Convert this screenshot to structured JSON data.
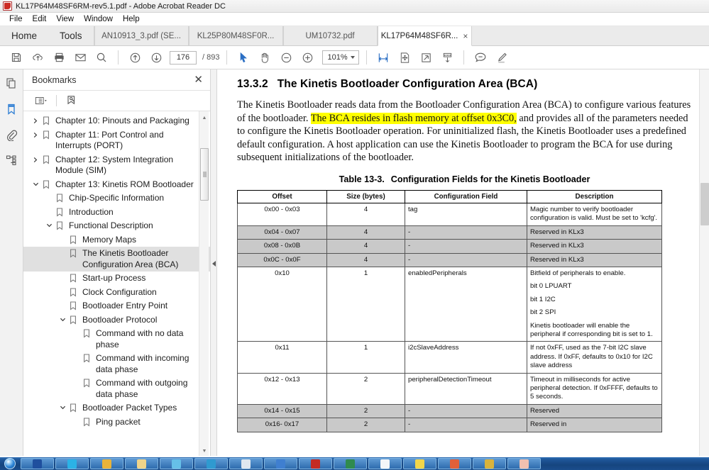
{
  "window": {
    "title": "KL17P64M48SF6RM-rev5.1.pdf - Adobe Acrobat Reader DC",
    "app_icon": "acrobat-logo-icon"
  },
  "menubar": {
    "items": [
      {
        "label": "File"
      },
      {
        "label": "Edit"
      },
      {
        "label": "View"
      },
      {
        "label": "Window"
      },
      {
        "label": "Help"
      }
    ]
  },
  "tabstrip": {
    "home_label": "Home",
    "tools_label": "Tools",
    "doc_tabs": [
      {
        "label": "AN10913_3.pdf (SE...",
        "active": false
      },
      {
        "label": "KL25P80M48SF0R...",
        "active": false
      },
      {
        "label": "UM10732.pdf",
        "active": false
      },
      {
        "label": "KL17P64M48SF6R...",
        "active": true,
        "close": "×"
      }
    ]
  },
  "toolbar": {
    "save_label": "save-icon",
    "upload_label": "cloud-upload-icon",
    "print_label": "print-icon",
    "email_label": "email-icon",
    "search_label": "search-icon",
    "prev_page_label": "previous-page-icon",
    "next_page_label": "next-page-icon",
    "page_number": "176",
    "page_total": "/ 893",
    "select_tool_label": "select-cursor-icon",
    "hand_tool_label": "hand-tool-icon",
    "zoom_out_label": "zoom-out-icon",
    "zoom_in_label": "zoom-in-icon",
    "zoom_value": "101%",
    "fit_width_label": "fit-width-icon",
    "pan_page_label": "pan-page-icon",
    "fit_page_label": "fit-page-icon",
    "read_mode_label": "read-mode-icon",
    "comment_label": "comment-icon",
    "highlight_label": "highlight-pen-icon"
  },
  "rail": {
    "items": [
      {
        "name": "page-thumbnails-icon",
        "active": false
      },
      {
        "name": "bookmarks-icon",
        "active": true
      },
      {
        "name": "attachments-icon",
        "active": false
      },
      {
        "name": "tags-icon",
        "active": false
      }
    ]
  },
  "bookmarks_panel": {
    "title": "Bookmarks",
    "close_label": "✕",
    "options_label": "bookmark-options-icon",
    "new_bookmark_label": "new-bookmark-icon",
    "items": [
      {
        "label": "Chapter 10: Pinouts and Packaging",
        "indent": 0,
        "arrow": "collapsed",
        "selected": false
      },
      {
        "label": "Chapter 11: Port Control and Interrupts (PORT)",
        "indent": 0,
        "arrow": "collapsed",
        "selected": false
      },
      {
        "label": "Chapter 12: System Integration Module (SIM)",
        "indent": 0,
        "arrow": "collapsed",
        "selected": false
      },
      {
        "label": "Chapter 13: Kinetis ROM Bootloader",
        "indent": 0,
        "arrow": "expanded",
        "selected": false
      },
      {
        "label": "Chip-Specific Information",
        "indent": 1,
        "arrow": "none",
        "selected": false
      },
      {
        "label": "Introduction",
        "indent": 1,
        "arrow": "none",
        "selected": false
      },
      {
        "label": "Functional Description",
        "indent": 1,
        "arrow": "expanded",
        "selected": false
      },
      {
        "label": "Memory Maps",
        "indent": 2,
        "arrow": "none",
        "selected": false
      },
      {
        "label": "The Kinetis Bootloader Configuration Area (BCA)",
        "indent": 2,
        "arrow": "none",
        "selected": true
      },
      {
        "label": "Start-up Process",
        "indent": 2,
        "arrow": "none",
        "selected": false
      },
      {
        "label": "Clock Configuration",
        "indent": 2,
        "arrow": "none",
        "selected": false
      },
      {
        "label": "Bootloader Entry Point",
        "indent": 2,
        "arrow": "none",
        "selected": false
      },
      {
        "label": "Bootloader Protocol",
        "indent": 2,
        "arrow": "expanded",
        "selected": false
      },
      {
        "label": "Command with no data phase",
        "indent": 3,
        "arrow": "none",
        "selected": false
      },
      {
        "label": "Command with incoming data phase",
        "indent": 3,
        "arrow": "none",
        "selected": false
      },
      {
        "label": "Command with outgoing data phase",
        "indent": 3,
        "arrow": "none",
        "selected": false
      },
      {
        "label": "Bootloader Packet Types",
        "indent": 2,
        "arrow": "expanded",
        "selected": false
      },
      {
        "label": "Ping packet",
        "indent": 3,
        "arrow": "none",
        "selected": false
      }
    ]
  },
  "document": {
    "heading_number": "13.3.2",
    "heading_title": "The Kinetis Bootloader Configuration Area (BCA)",
    "paragraph": {
      "part1": "The Kinetis Bootloader reads data from the Bootloader Configuration Area (BCA) to configure various features of the bootloader. ",
      "highlight": "The BCA resides in flash memory at offset 0x3C0,",
      "part2": " and provides all of the parameters needed to configure the Kinetis Bootloader operation. For uninitialized flash, the Kinetis Bootloader uses a predefined default configuration. A host application can use the Kinetis Bootloader to program the BCA for use during subsequent initializations of the bootloader."
    },
    "table_caption_number": "Table 13-3.",
    "table_caption_text": "Configuration Fields for the Kinetis Bootloader",
    "table": {
      "headers": [
        "Offset",
        "Size (bytes)",
        "Configuration Field",
        "Description"
      ],
      "rows": [
        {
          "shaded": false,
          "offset": "0x00 - 0x03",
          "size": "4",
          "field": "tag",
          "description_lines": [
            "Magic number to verify bootloader configuration is valid. Must be set to 'kcfg'."
          ]
        },
        {
          "shaded": true,
          "offset": "0x04 - 0x07",
          "size": "4",
          "field": "-",
          "description_lines": [
            "Reserved in KLx3"
          ]
        },
        {
          "shaded": true,
          "offset": "0x08 - 0x0B",
          "size": "4",
          "field": "-",
          "description_lines": [
            "Reserved in KLx3"
          ]
        },
        {
          "shaded": true,
          "offset": "0x0C - 0x0F",
          "size": "4",
          "field": "-",
          "description_lines": [
            "Reserved in KLx3"
          ]
        },
        {
          "shaded": false,
          "offset": "0x10",
          "size": "1",
          "field": "enabledPeripherals",
          "description_lines": [
            "Bitfield of peripherals to enable.",
            "bit 0 LPUART",
            "bit 1 I2C",
            "bit 2 SPI",
            "Kinetis bootloader will enable the peripheral if corresponding bit is set to 1."
          ]
        },
        {
          "shaded": false,
          "offset": "0x11",
          "size": "1",
          "field": "i2cSlaveAddress",
          "description_lines": [
            "If not 0xFF, used as the 7-bit I2C slave address. If 0xFF, defaults to 0x10 for I2C slave address"
          ]
        },
        {
          "shaded": false,
          "offset": "0x12 - 0x13",
          "size": "2",
          "field": "peripheralDetectionTimeout",
          "description_lines": [
            "Timeout in milliseconds for active peripheral detection. If 0xFFFF, defaults to 5 seconds."
          ]
        },
        {
          "shaded": true,
          "offset": "0x14 - 0x15",
          "size": "2",
          "field": "-",
          "description_lines": [
            "Reserved"
          ]
        },
        {
          "shaded": true,
          "offset": "0x16- 0x17",
          "size": "2",
          "field": "-",
          "description_lines": [
            "Reserved in"
          ]
        }
      ]
    }
  },
  "taskbar": {
    "start_label": "start-orb-icon",
    "items": [
      {
        "name": "taskbar-item-outlook",
        "color": "#1f4f9e"
      },
      {
        "name": "taskbar-item-skype",
        "color": "#2bb2e6"
      },
      {
        "name": "taskbar-item-paint",
        "color": "#e8b33a"
      },
      {
        "name": "taskbar-item-explorer-folder",
        "color": "#f0d48a"
      },
      {
        "name": "taskbar-item-ie",
        "color": "#66c0e8"
      },
      {
        "name": "taskbar-item-office",
        "color": "#2f9ad0"
      },
      {
        "name": "taskbar-item-notepad",
        "color": "#dfe7ef"
      },
      {
        "name": "taskbar-item-mail",
        "color": "#3f7fd0"
      },
      {
        "name": "taskbar-item-acrobat",
        "color": "#c42b23"
      },
      {
        "name": "taskbar-item-excel",
        "color": "#2f8b4f"
      },
      {
        "name": "taskbar-item-word",
        "color": "#f4f6f8"
      },
      {
        "name": "taskbar-item-sketch",
        "color": "#f2d64a"
      },
      {
        "name": "taskbar-item-tool",
        "color": "#e2603a"
      },
      {
        "name": "taskbar-item-media",
        "color": "#d9b33c"
      },
      {
        "name": "taskbar-item-image",
        "color": "#f0c0b0"
      }
    ]
  }
}
